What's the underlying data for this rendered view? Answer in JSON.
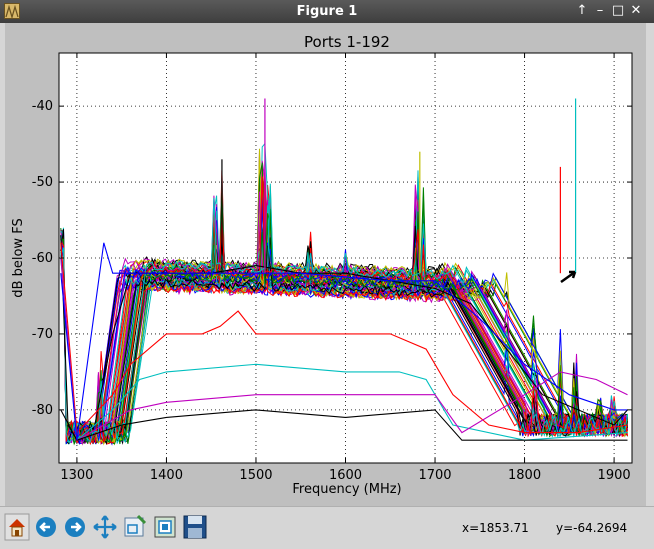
{
  "window": {
    "title": "Figure 1",
    "controls": [
      "up-arrow-icon",
      "minimize-icon",
      "maximize-icon",
      "close-icon"
    ]
  },
  "toolbar": {
    "buttons": [
      "home-icon",
      "back-icon",
      "forward-icon",
      "pan-icon",
      "zoom-icon",
      "configure-subplots-icon",
      "save-icon"
    ],
    "x_readout": "x=1853.71",
    "y_readout": "y=-64.2694"
  },
  "colors": {
    "figure_bg": "#bfbfbf",
    "plot_bg": "#ffffff",
    "titlebar": "#4a4a4a"
  },
  "chart_data": {
    "type": "line",
    "title": "Ports 1-192",
    "xlabel": "Frequency (MHz)",
    "ylabel": "dB below FS",
    "xlim": [
      1280,
      1920
    ],
    "ylim": [
      -87,
      -33
    ],
    "xticks": [
      1300,
      1400,
      1500,
      1600,
      1700,
      1800,
      1900
    ],
    "yticks": [
      -40,
      -50,
      -60,
      -70,
      -80
    ],
    "grid": true,
    "series_colors": [
      "#0000ff",
      "#008000",
      "#ff0000",
      "#00bfbf",
      "#bf00bf",
      "#bfbf00",
      "#000000"
    ],
    "representative_series": [
      {
        "color": "#000000",
        "points": [
          [
            1282,
            -57
          ],
          [
            1290,
            -82
          ],
          [
            1300,
            -84
          ],
          [
            1320,
            -82
          ],
          [
            1340,
            -70
          ],
          [
            1360,
            -62
          ],
          [
            1400,
            -62
          ],
          [
            1450,
            -62
          ],
          [
            1500,
            -61
          ],
          [
            1550,
            -62
          ],
          [
            1600,
            -62
          ],
          [
            1650,
            -63
          ],
          [
            1700,
            -64
          ],
          [
            1740,
            -66
          ],
          [
            1780,
            -72
          ],
          [
            1820,
            -78
          ],
          [
            1860,
            -80
          ],
          [
            1900,
            -82
          ],
          [
            1915,
            -80
          ]
        ]
      },
      {
        "color": "#ff0000",
        "points": [
          [
            1282,
            -58
          ],
          [
            1300,
            -83
          ],
          [
            1340,
            -78
          ],
          [
            1360,
            -74
          ],
          [
            1400,
            -70
          ],
          [
            1440,
            -70
          ],
          [
            1460,
            -69
          ],
          [
            1480,
            -67
          ],
          [
            1500,
            -70
          ],
          [
            1550,
            -70
          ],
          [
            1600,
            -70
          ],
          [
            1650,
            -70
          ],
          [
            1690,
            -72
          ],
          [
            1720,
            -78
          ],
          [
            1760,
            -82
          ],
          [
            1800,
            -83
          ],
          [
            1860,
            -83
          ],
          [
            1915,
            -82
          ]
        ]
      },
      {
        "color": "#00bfbf",
        "points": [
          [
            1282,
            -60
          ],
          [
            1300,
            -84
          ],
          [
            1340,
            -80
          ],
          [
            1370,
            -76
          ],
          [
            1400,
            -75
          ],
          [
            1500,
            -74
          ],
          [
            1600,
            -75
          ],
          [
            1660,
            -75
          ],
          [
            1690,
            -76
          ],
          [
            1720,
            -82
          ],
          [
            1800,
            -84
          ],
          [
            1915,
            -83
          ]
        ]
      },
      {
        "color": "#bf00bf",
        "points": [
          [
            1282,
            -60
          ],
          [
            1300,
            -84
          ],
          [
            1360,
            -80
          ],
          [
            1400,
            -79
          ],
          [
            1500,
            -78
          ],
          [
            1600,
            -78
          ],
          [
            1700,
            -78
          ],
          [
            1730,
            -83
          ],
          [
            1800,
            -78
          ],
          [
            1840,
            -75
          ],
          [
            1880,
            -76
          ],
          [
            1915,
            -78
          ]
        ]
      },
      {
        "color": "#000000",
        "points": [
          [
            1282,
            -80
          ],
          [
            1300,
            -84
          ],
          [
            1350,
            -82
          ],
          [
            1400,
            -81
          ],
          [
            1500,
            -80
          ],
          [
            1600,
            -81
          ],
          [
            1700,
            -80
          ],
          [
            1730,
            -84
          ],
          [
            1800,
            -84
          ],
          [
            1915,
            -84
          ]
        ]
      },
      {
        "color": "#0000ff",
        "points": [
          [
            1282,
            -62
          ],
          [
            1300,
            -84
          ],
          [
            1330,
            -58
          ],
          [
            1340,
            -62
          ],
          [
            1360,
            -62
          ],
          [
            1450,
            -62
          ],
          [
            1550,
            -62
          ],
          [
            1650,
            -63
          ],
          [
            1700,
            -63
          ],
          [
            1750,
            -68
          ],
          [
            1800,
            -74
          ],
          [
            1850,
            -78
          ],
          [
            1900,
            -80
          ],
          [
            1915,
            -80
          ]
        ]
      }
    ],
    "annotations": [
      {
        "type": "peak",
        "x": 1840,
        "y": -48
      },
      {
        "type": "peak",
        "x": 1857,
        "y": -39
      },
      {
        "type": "peak",
        "x": 1510,
        "y": -39
      },
      {
        "type": "peak",
        "x": 1683,
        "y": -46
      },
      {
        "type": "peak",
        "x": 1462,
        "y": -47
      }
    ]
  }
}
